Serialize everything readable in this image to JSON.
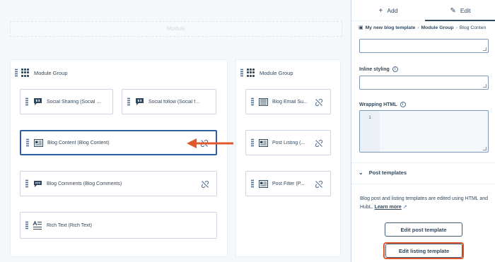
{
  "canvas": {
    "top_strip_label": "Module",
    "groups": [
      {
        "title": "Module Group",
        "modules": [
          {
            "label": "Social Sharing (Social ...",
            "icon": "speech-bubble-icon"
          },
          {
            "label": "Social follow (Social f...",
            "icon": "speech-bubble-icon"
          },
          {
            "label": "Blog Content (Blog Content)",
            "icon": "blog-content-icon",
            "active": true
          },
          {
            "label": "Blog Comments (Blog Comments)",
            "icon": "comments-icon"
          },
          {
            "label": "Rich Text (Rich Text)",
            "icon": "rich-text-icon"
          }
        ]
      },
      {
        "title": "Module Group",
        "modules": [
          {
            "label": "Blog Email Su...",
            "icon": "email-subscribe-icon"
          },
          {
            "label": "Post Listing (...",
            "icon": "blog-content-icon"
          },
          {
            "label": "Post Filter (P...",
            "icon": "blog-content-icon"
          }
        ]
      }
    ]
  },
  "panel": {
    "tabs": [
      {
        "label": "Add",
        "glyph": "+"
      },
      {
        "label": "Edit",
        "glyph": "✎",
        "active": true
      }
    ],
    "breadcrumb": {
      "items": [
        "My new blog template",
        "Module Group"
      ],
      "current": "Blog Conten",
      "separator": "›"
    },
    "fields": {
      "inline_styling_label": "Inline styling",
      "wrapping_html_label": "Wrapping HTML",
      "line_number": "1"
    },
    "post_templates": {
      "heading": "Post templates",
      "description": "Blog post and listing templates are edited using HTML and HubL.",
      "learn_more": "Learn more",
      "edit_post_button": "Edit post template",
      "edit_listing_button": "Edit listing template"
    }
  },
  "colors": {
    "accent_arrow": "#e0582b",
    "active_border": "#2d5e9e",
    "highlight_border": "#d9572b"
  }
}
